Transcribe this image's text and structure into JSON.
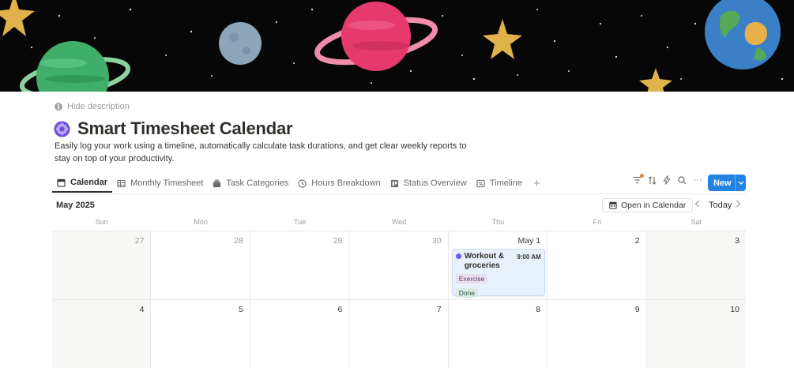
{
  "page": {
    "hide_description": "Hide description",
    "title": "Smart Timesheet Calendar",
    "description": "Easily log your work using a timeline, automatically calculate task durations, and get clear weekly reports to stay on top of your productivity."
  },
  "tabs": [
    {
      "label": "Calendar",
      "icon": "calendar-icon",
      "active": true
    },
    {
      "label": "Monthly Timesheet",
      "icon": "table-icon"
    },
    {
      "label": "Task Categories",
      "icon": "stack-icon"
    },
    {
      "label": "Hours Breakdown",
      "icon": "clock-icon"
    },
    {
      "label": "Status Overview",
      "icon": "board-icon"
    },
    {
      "label": "Timeline",
      "icon": "timeline-icon"
    }
  ],
  "toolbar": {
    "add_tab": "+",
    "more": "···",
    "new_label": "New"
  },
  "calendar": {
    "month_label": "May 2025",
    "open_in_calendar": "Open in Calendar",
    "today": "Today",
    "weekdays": [
      "Sun",
      "Mon",
      "Tue",
      "Wed",
      "Thu",
      "Fri",
      "Sat"
    ],
    "weeks": [
      [
        {
          "day": "27",
          "muted": true,
          "shade": true
        },
        {
          "day": "28",
          "muted": true
        },
        {
          "day": "29",
          "muted": true
        },
        {
          "day": "30",
          "muted": true
        },
        {
          "day": "May 1"
        },
        {
          "day": "2"
        },
        {
          "day": "3",
          "shade": true
        }
      ],
      [
        {
          "day": "4",
          "shade": true
        },
        {
          "day": "5"
        },
        {
          "day": "6"
        },
        {
          "day": "7"
        },
        {
          "day": "8"
        },
        {
          "day": "9"
        },
        {
          "day": "10",
          "shade": true
        }
      ]
    ],
    "event": {
      "title": "Workout & groceries",
      "time": "9:00 AM",
      "category": "Exercise",
      "status": "Done",
      "dot_color": "#6c5ce7"
    }
  },
  "colors": {
    "accent": "#2383e2",
    "event_bg": "#e8f0fb"
  }
}
